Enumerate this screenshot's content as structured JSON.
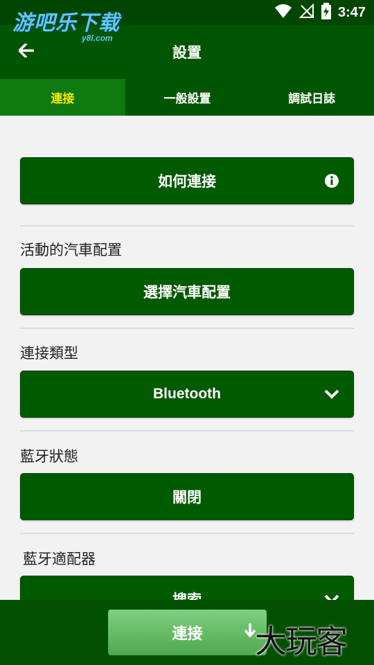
{
  "status_bar": {
    "time": "3:47"
  },
  "watermark": {
    "text": "游吧乐下载",
    "sub": "y8l.com"
  },
  "header": {
    "title": "設置"
  },
  "tabs": [
    {
      "label": "連接",
      "active": true
    },
    {
      "label": "一般設置",
      "active": false
    },
    {
      "label": "調試日誌",
      "active": false
    }
  ],
  "sections": {
    "how_to_connect": {
      "label": "如何連接"
    },
    "active_car_config": {
      "title": "活動的汽車配置",
      "button": "選擇汽車配置"
    },
    "connection_type": {
      "title": "連接類型",
      "value": "Bluetooth"
    },
    "bluetooth_state": {
      "title": "藍牙狀態",
      "value": "關閉"
    },
    "bluetooth_adapter": {
      "title": "藍牙適配器",
      "value": "搜索"
    }
  },
  "bottom": {
    "connect_label": "連接",
    "watermark": "大玩客"
  },
  "colors": {
    "primary": "#005a00",
    "app_bar": "#005600",
    "tab_active": "#0f7a0f",
    "tab_active_text": "#ffe600",
    "connect_button": "#66bb66"
  },
  "icons": {
    "back": "arrow-left-icon",
    "info": "info-icon",
    "dropdown": "chevron-down-icon",
    "download": "arrow-down-icon"
  }
}
